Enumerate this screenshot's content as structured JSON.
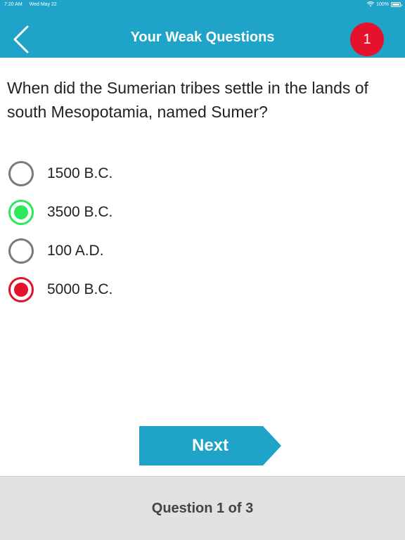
{
  "status_bar": {
    "time": "7:20 AM",
    "date": "Wed May 22",
    "battery": "100%"
  },
  "nav": {
    "title": "Your Weak Questions",
    "badge_count": "1",
    "back_icon": "chevron-left-icon"
  },
  "question": {
    "text": "When did the Sumerian tribes settle in the lands of south Mesopotamia, named Sumer?"
  },
  "options": [
    {
      "label": "1500 B.C.",
      "state": "unselected"
    },
    {
      "label": "3500 B.C.",
      "state": "correct"
    },
    {
      "label": "100 A.D.",
      "state": "unselected"
    },
    {
      "label": "5000 B.C.",
      "state": "wrong"
    }
  ],
  "next_button": {
    "label": "Next"
  },
  "footer": {
    "progress_label": "Question 1 of 3"
  },
  "colors": {
    "primary": "#1fa3c9",
    "correct": "#2ee85c",
    "wrong": "#e4122a",
    "neutral": "#7a7a7a"
  }
}
